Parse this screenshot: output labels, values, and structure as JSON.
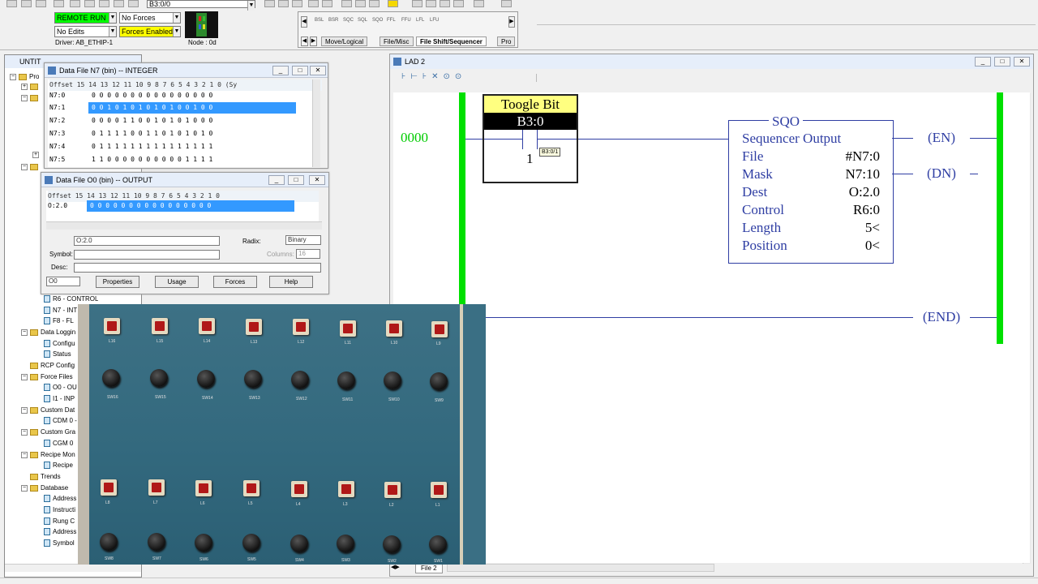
{
  "toolbar": {
    "address": "B3:0/0",
    "mode": "REMOTE RUN",
    "forces": "No Forces",
    "edits": "No Edits",
    "forces_enabled": "Forces Enabled",
    "driver": "Driver: AB_ETHIP-1",
    "node": "Node : 0d",
    "mode_color": "#00ff00",
    "forces_enabled_color": "#ffff00",
    "instr_tabs": [
      "Move/Logical",
      "File/Misc",
      "File Shift/Sequencer",
      "Pro"
    ],
    "mnemonics": [
      "BSL",
      "BSR",
      "SQC",
      "SQL",
      "SQO",
      "FFL",
      "FFU",
      "LFL",
      "LFU"
    ]
  },
  "tree": {
    "title": "UNTIT",
    "items": [
      "Pro",
      "R6 - CONTROL",
      "N7 - INT",
      "F8 - FL",
      "Data Loggin",
      "Configu",
      "Status",
      "RCP Config",
      "Force Files",
      "O0 - OU",
      "I1 - INP",
      "Custom Dat",
      "CDM 0 -",
      "Custom Gra",
      "CGM 0",
      "Recipe Mon",
      "Recipe",
      "Trends",
      "Database",
      "Address",
      "Instructi",
      "Rung C",
      "Address",
      "Symbol"
    ]
  },
  "n7_window": {
    "title": "Data File N7 (bin)  --  INTEGER",
    "header": "Offset  15 14 13 12 11 10  9  8  7  6  5  4  3  2  1  0    (Sy",
    "rows": [
      {
        "offset": "N7:0",
        "bits": "0  0  0  0  0  0  0  0  0  0  0  0  0  0  0  0"
      },
      {
        "offset": "N7:1",
        "bits": "0  0  1  0  1  0  1  0  1  0  1  0  0  1  0  0"
      },
      {
        "offset": "N7:2",
        "bits": "0  0  0  0  1  1  0  0  1  0  1  0  1  0  0  0"
      },
      {
        "offset": "N7:3",
        "bits": "0  1  1  1  1  0  0  1  1  0  1  0  1  0  1  0"
      },
      {
        "offset": "N7:4",
        "bits": "0  1  1  1  1  1  1  1  1  1  1  1  1  1  1  1"
      },
      {
        "offset": "N7:5",
        "bits": "1  1  0  0  0  0  0  0  0  0  0  0  1  1  1  1"
      }
    ]
  },
  "o0_window": {
    "title": "Data File O0 (bin)  --  OUTPUT",
    "header": "Offset  15 14 13 12 11 10  9  8  7  6  5  4  3  2  1  0",
    "row_offset": "O:2.0",
    "row_bits": "0  0  0  0  0  0  0  0  0  0  0  0  0  0  0  0",
    "address_field": "O:2.0",
    "radix_label": "Radix:",
    "radix_value": "Binary",
    "symbol_label": "Symbol:",
    "columns_label": "Columns:",
    "columns_value": "16",
    "desc_label": "Desc:",
    "file_value": "O0",
    "buttons": [
      "Properties",
      "Usage",
      "Forces",
      "Help"
    ]
  },
  "ladder": {
    "title": "LAD 2",
    "rung_number": "0000",
    "contact_title": "Toogle Bit",
    "contact_address": "B3:0",
    "contact_bit": "1",
    "tooltip": "B3:0/1",
    "instr_name": "SQO",
    "instr_desc": "Sequencer Output",
    "params": [
      {
        "label": "File",
        "value": "#N7:0"
      },
      {
        "label": "Mask",
        "value": "N7:10"
      },
      {
        "label": "Dest",
        "value": "O:2.0"
      },
      {
        "label": "Control",
        "value": "R6:0"
      },
      {
        "label": "Length",
        "value": "5<"
      },
      {
        "label": "Position",
        "value": "0<"
      }
    ],
    "coil_en": "EN",
    "coil_dn": "DN",
    "end_label": "END",
    "file_tab": "File 2",
    "rung_color": "#00cc00",
    "rail_color": "#00e000",
    "wire_color": "#2f3ea3"
  },
  "photo": {
    "lamp_labels_top": [
      "L16",
      "L15",
      "L14",
      "L13",
      "L12",
      "L11",
      "L10",
      "L9"
    ],
    "switch_labels_top": [
      "SW16",
      "SW15",
      "SW14",
      "SW13",
      "SW12",
      "SW11",
      "SW10",
      "SW9"
    ],
    "lamp_labels_bottom": [
      "L8",
      "L7",
      "L6",
      "L5",
      "L4",
      "L3",
      "L2",
      "L1"
    ],
    "switch_labels_bottom": [
      "SW8",
      "SW7",
      "SW6",
      "SW5",
      "SW4",
      "SW3",
      "SW2",
      "SW1"
    ]
  }
}
